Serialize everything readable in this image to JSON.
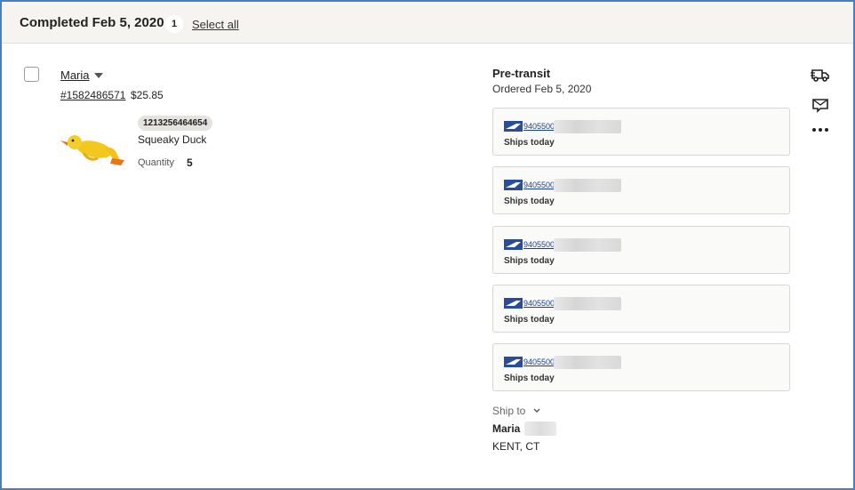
{
  "header": {
    "title": "Completed Feb 5, 2020",
    "count": "1",
    "select_all": "Select all"
  },
  "order": {
    "buyer": "Maria",
    "order_number": "#1582486571",
    "total": "$25.85",
    "item": {
      "sku": "1213256464654",
      "title": "Squeaky Duck",
      "quantity_label": "Quantity",
      "quantity": "5"
    }
  },
  "shipping": {
    "status": "Pre-transit",
    "ordered": "Ordered Feb 5, 2020",
    "labels": [
      {
        "tracking": "94055008",
        "ship_text": "Ships today"
      },
      {
        "tracking": "94055008",
        "ship_text": "Ships today"
      },
      {
        "tracking": "94055008",
        "ship_text": "Ships today"
      },
      {
        "tracking": "94055008",
        "ship_text": "Ships today"
      },
      {
        "tracking": "94055008",
        "ship_text": "Ships today"
      }
    ],
    "ship_to_label": "Ship to",
    "recipient_name": "Maria",
    "recipient_city": "KENT, CT"
  },
  "icons": {
    "truck": "truck-icon",
    "mail": "mail-icon",
    "more": "more-icon",
    "usps": "usps-eagle-icon"
  },
  "colors": {
    "frame": "#4a7ec2",
    "header_bg": "#f5f4f1",
    "tracking_link": "#1a3d8f",
    "usps_blue": "#2a4d9a"
  }
}
